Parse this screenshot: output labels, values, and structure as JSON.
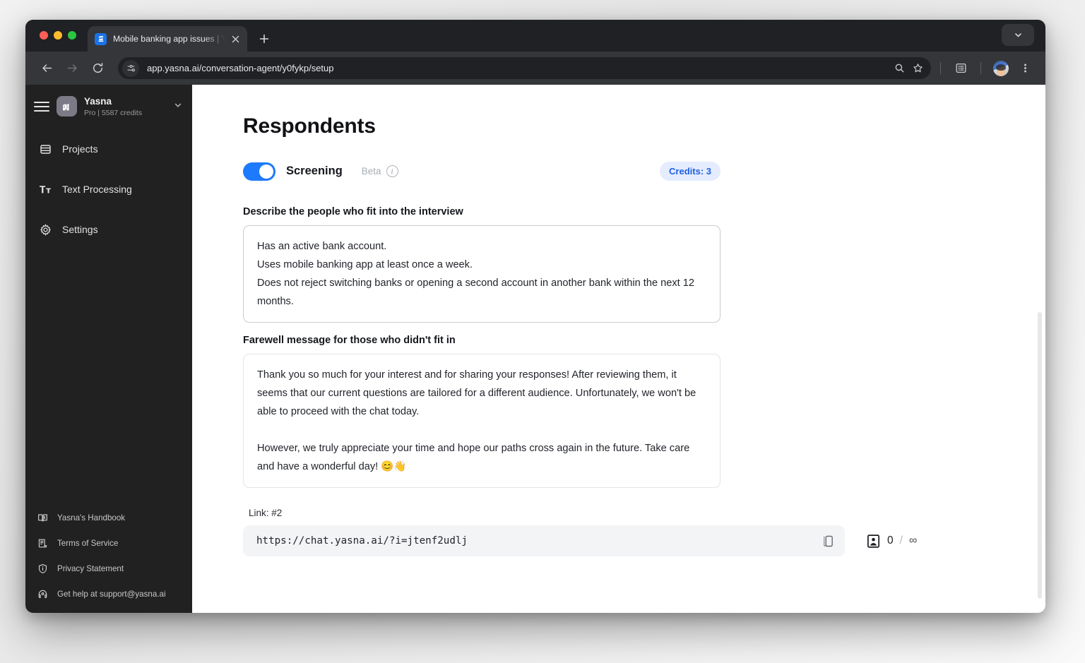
{
  "browser": {
    "tab": {
      "title": "Mobile banking app issues | Y",
      "favicon_icon": "yasna-logo-icon",
      "close_icon": "close-icon"
    },
    "new_tab_icon": "plus-icon",
    "tabstrip_chevron_icon": "chevron-down-icon",
    "toolbar": {
      "back_icon": "arrow-left-icon",
      "forward_icon": "arrow-right-icon",
      "reload_icon": "reload-icon",
      "site_settings_icon": "tune-icon",
      "url": "app.yasna.ai/conversation-agent/y0fykp/setup",
      "zoom_search_icon": "search-icon",
      "bookmark_icon": "star-icon",
      "reading_list_icon": "reading-list-icon",
      "profile_avatar_name": "avatar",
      "menu_icon": "kebab-menu-icon"
    }
  },
  "sidebar": {
    "menu_icon": "hamburger-icon",
    "workspace": {
      "logo_icon": "building-icon",
      "name": "Yasna",
      "plan": "Pro | 5587 credits",
      "chevron_icon": "chevron-down-icon"
    },
    "nav": [
      {
        "label": "Projects",
        "icon": "projects-icon"
      },
      {
        "label": "Text Processing",
        "icon": "text-processing-icon"
      },
      {
        "label": "Settings",
        "icon": "gear-icon"
      }
    ],
    "footer": [
      {
        "label": "Yasna's Handbook",
        "icon": "book-icon"
      },
      {
        "label": "Terms of Service",
        "icon": "document-icon"
      },
      {
        "label": "Privacy Statement",
        "icon": "shield-info-icon"
      },
      {
        "label": "Get help at support@yasna.ai",
        "icon": "support-icon"
      }
    ]
  },
  "main": {
    "page_title": "Respondents",
    "screening": {
      "toggle_on": true,
      "label": "Screening",
      "beta_label": "Beta",
      "info_icon": "info-icon",
      "credits_badge": "Credits: 3"
    },
    "describe": {
      "label": "Describe the people who fit into the interview",
      "value": "Has an active bank account.\nUses mobile banking app at least once a week.\nDoes not reject switching banks or opening a second account in another bank within the next 12 months."
    },
    "farewell": {
      "label": "Farewell message for those who didn't fit in",
      "value": "Thank you so much for your interest and for sharing your responses! After reviewing them, it seems that our current questions are tailored for a different audience. Unfortunately, we won't be able to proceed with the chat today.\n\nHowever, we truly appreciate your time and hope our paths cross again in the future. Take care and have a wonderful day! 😊👋"
    },
    "link": {
      "label": "Link: #2",
      "url": "https://chat.yasna.ai/?i=jtenf2udlj",
      "copy_icon": "copy-icon",
      "respondent_icon": "contact-card-icon",
      "count": "0",
      "separator": "/",
      "total": "∞"
    }
  },
  "colors": {
    "accent_blue": "#1d7afc",
    "badge_bg": "#e4ecfe",
    "badge_text": "#1f5fe0",
    "sidebar_bg": "#212121",
    "browser_chrome": "#35363a"
  }
}
